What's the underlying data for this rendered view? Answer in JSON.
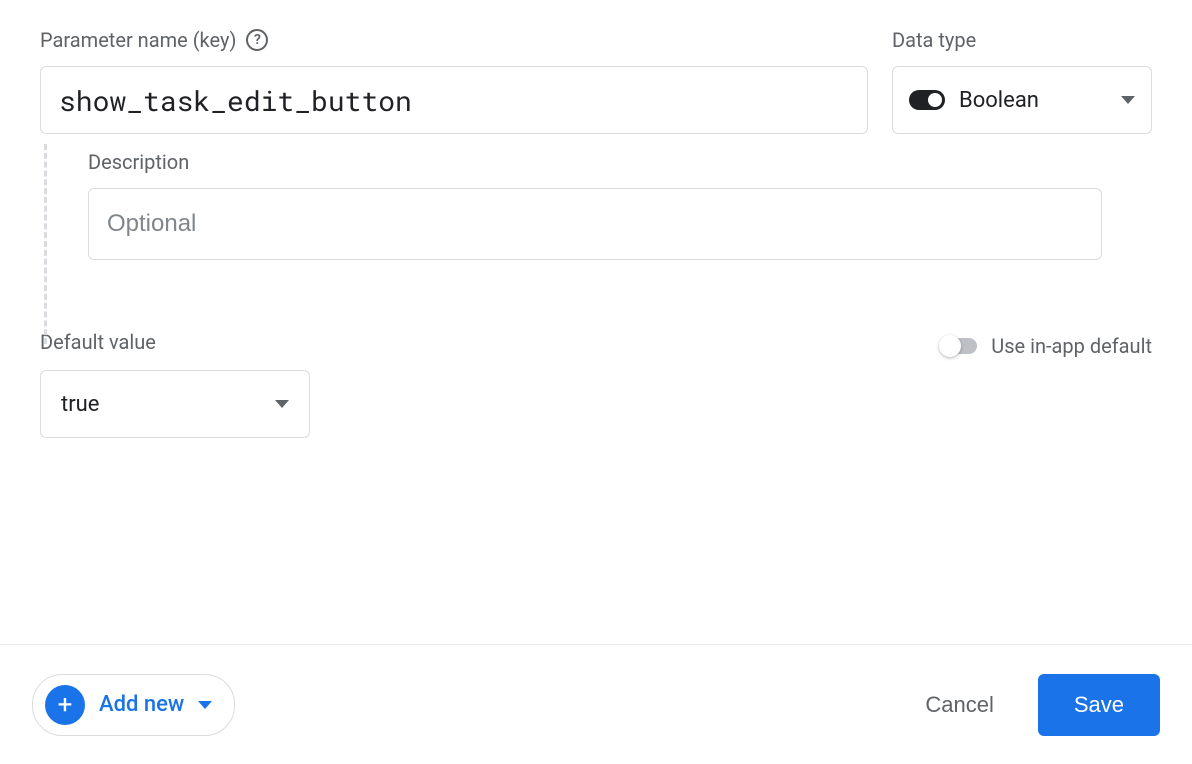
{
  "parameterName": {
    "label": "Parameter name (key)",
    "value": "show_task_edit_button"
  },
  "dataType": {
    "label": "Data type",
    "selected": "Boolean"
  },
  "description": {
    "label": "Description",
    "placeholder": "Optional",
    "value": ""
  },
  "defaultValue": {
    "label": "Default value",
    "selected": "true"
  },
  "inAppDefault": {
    "label": "Use in-app default",
    "enabled": false
  },
  "footer": {
    "addNew": "Add new",
    "cancel": "Cancel",
    "save": "Save"
  }
}
